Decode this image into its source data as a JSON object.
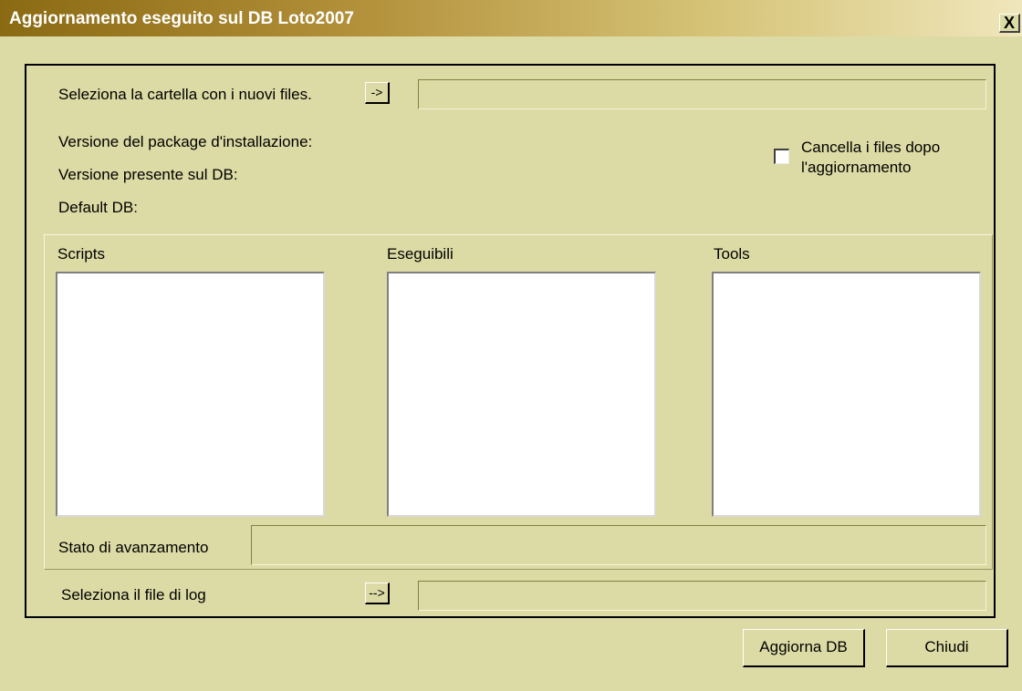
{
  "window": {
    "title": "Aggiornamento eseguito sul DB Loto2007",
    "close_label": "X"
  },
  "folder": {
    "label": "Seleziona la cartella con i nuovi files.",
    "browse_label": "->",
    "path_value": ""
  },
  "info": {
    "package_version_label": "Versione del package d'installazione:",
    "db_version_label": "Versione presente sul DB:",
    "default_db_label": "Default DB:"
  },
  "delete_option": {
    "label_line1": "Cancella i files dopo",
    "label_line2": "l'aggiornamento",
    "checked": false
  },
  "lists": {
    "scripts_label": "Scripts",
    "executables_label": "Eseguibili",
    "tools_label": "Tools"
  },
  "progress": {
    "label": "Stato di avanzamento",
    "value": ""
  },
  "log": {
    "label": "Seleziona il file di log",
    "browse_label": "-->",
    "path_value": ""
  },
  "buttons": {
    "update_label": "Aggiorna DB",
    "close_label": "Chiudi"
  }
}
